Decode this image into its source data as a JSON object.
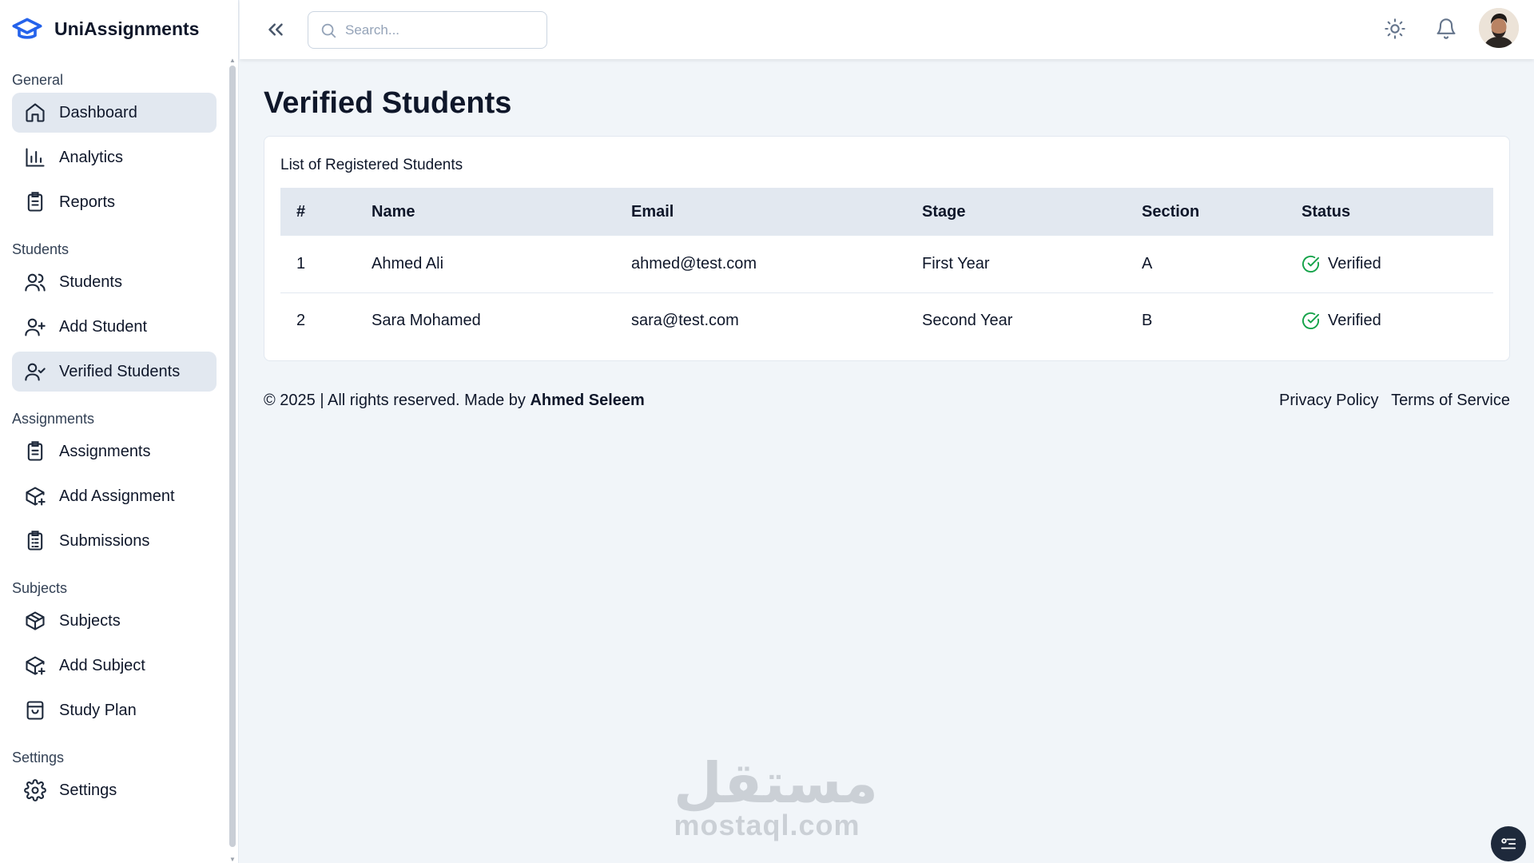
{
  "app": {
    "name": "UniAssignments"
  },
  "sidebar": {
    "groups": [
      {
        "title": "General",
        "items": [
          {
            "label": "Dashboard",
            "icon": "home-icon",
            "active": true
          },
          {
            "label": "Analytics",
            "icon": "bar-chart-icon"
          },
          {
            "label": "Reports",
            "icon": "clipboard-list-icon"
          }
        ]
      },
      {
        "title": "Students",
        "items": [
          {
            "label": "Students",
            "icon": "users-icon"
          },
          {
            "label": "Add Student",
            "icon": "user-plus-icon"
          },
          {
            "label": "Verified Students",
            "icon": "user-check-icon",
            "active": true
          }
        ]
      },
      {
        "title": "Assignments",
        "items": [
          {
            "label": "Assignments",
            "icon": "clipboard-list-icon"
          },
          {
            "label": "Add Assignment",
            "icon": "package-plus-icon"
          },
          {
            "label": "Submissions",
            "icon": "clipboard-check-icon"
          }
        ]
      },
      {
        "title": "Subjects",
        "items": [
          {
            "label": "Subjects",
            "icon": "package-icon"
          },
          {
            "label": "Add Subject",
            "icon": "package-plus-icon"
          },
          {
            "label": "Study Plan",
            "icon": "shopping-bag-icon"
          }
        ]
      },
      {
        "title": "Settings",
        "items": [
          {
            "label": "Settings",
            "icon": "gear-icon"
          }
        ]
      }
    ]
  },
  "header": {
    "search_placeholder": "Search...",
    "icons": [
      "collapse-sidebar-icon",
      "sun-icon",
      "bell-icon",
      "avatar"
    ]
  },
  "main": {
    "title": "Verified Students",
    "card_title": "List of Registered Students",
    "columns": [
      "#",
      "Name",
      "Email",
      "Stage",
      "Section",
      "Status"
    ],
    "rows": [
      {
        "num": "1",
        "name": "Ahmed Ali",
        "email": "ahmed@test.com",
        "stage": "First Year",
        "section": "A",
        "status": "Verified"
      },
      {
        "num": "2",
        "name": "Sara Mohamed",
        "email": "sara@test.com",
        "stage": "Second Year",
        "section": "B",
        "status": "Verified"
      }
    ]
  },
  "footer": {
    "copyright": "© 2025 | All rights reserved. Made by ",
    "author": "Ahmed Seleem",
    "links": [
      "Privacy Policy",
      "Terms of Service"
    ]
  },
  "watermark": {
    "arabic": "مستقل",
    "latin": "mostaql.com"
  },
  "colors": {
    "accent": "#2563eb",
    "verified": "#16a34a",
    "active_bg": "#e2e8f0",
    "page_bg": "#f1f5f9"
  }
}
